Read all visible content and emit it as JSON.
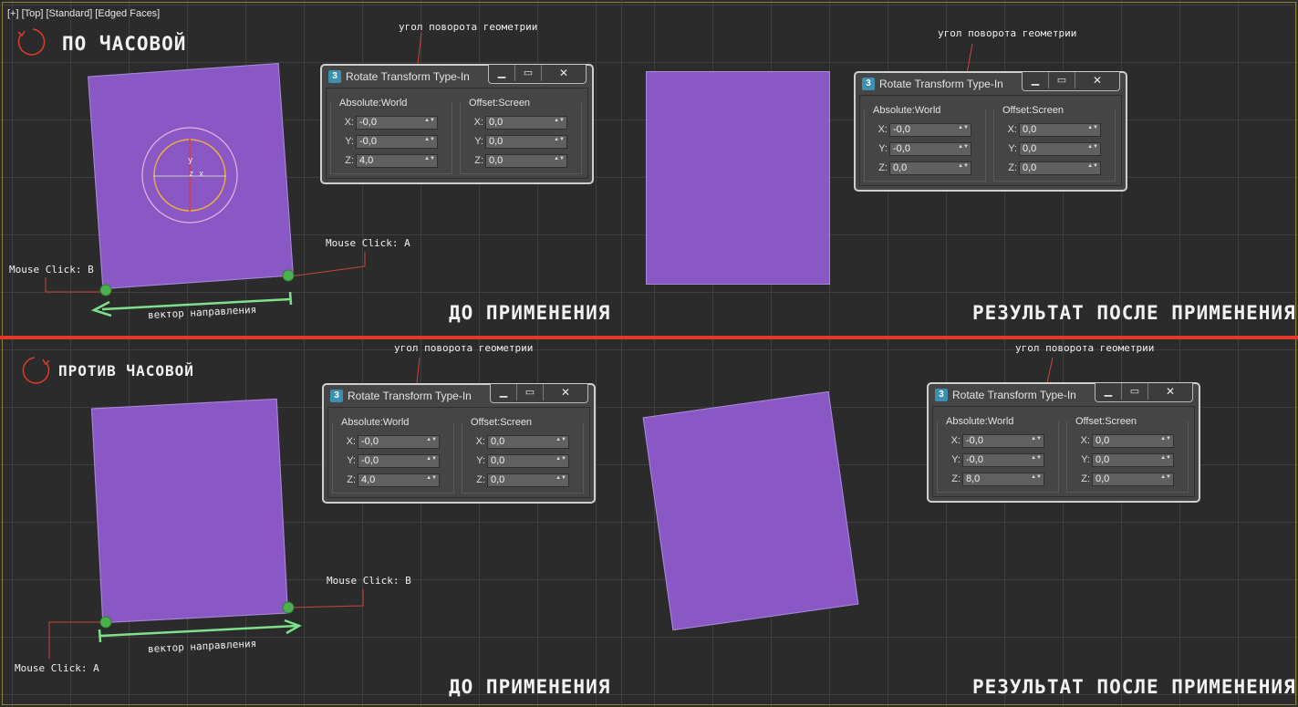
{
  "viewport_label": "[+] [Top] [Standard] [Edged Faces]",
  "top": {
    "direction_label": "ПО ЧАСОВОЙ",
    "before_caption": "ДО ПРИМЕНЕНИЯ",
    "after_caption": "РЕЗУЛЬТАТ ПОСЛЕ ПРИМЕНЕНИЯ",
    "angle_note_left": "угол поворота геометрии",
    "angle_note_right": "угол поворота геометрии",
    "click_a": "Mouse Click: A",
    "click_b": "Mouse Click: B",
    "vector": "вектор направления",
    "gizmo_y": "y",
    "gizmo_zx": "z x",
    "dialog_left": {
      "title": "Rotate Transform Type-In",
      "abs_title": "Absolute:World",
      "off_title": "Offset:Screen",
      "lx": "X:",
      "ly": "Y:",
      "lz": "Z:",
      "ax": "-0,0",
      "ay": "-0,0",
      "az": "4,0",
      "ox": "0,0",
      "oy": "0,0",
      "oz": "0,0"
    },
    "dialog_right": {
      "title": "Rotate Transform Type-In",
      "abs_title": "Absolute:World",
      "off_title": "Offset:Screen",
      "lx": "X:",
      "ly": "Y:",
      "lz": "Z:",
      "ax": "-0,0",
      "ay": "-0,0",
      "az": "0,0",
      "ox": "0,0",
      "oy": "0,0",
      "oz": "0,0"
    }
  },
  "bottom": {
    "direction_label": "ПРОТИВ ЧАСОВОЙ",
    "before_caption": "ДО ПРИМЕНЕНИЯ",
    "after_caption": "РЕЗУЛЬТАТ ПОСЛЕ ПРИМЕНЕНИЯ",
    "angle_note_left": "угол поворота геометрии",
    "angle_note_right": "угол поворота геометрии",
    "click_a": "Mouse Click: A",
    "click_b": "Mouse Click: B",
    "vector": "вектор направления",
    "dialog_left": {
      "title": "Rotate Transform Type-In",
      "abs_title": "Absolute:World",
      "off_title": "Offset:Screen",
      "lx": "X:",
      "ly": "Y:",
      "lz": "Z:",
      "ax": "-0,0",
      "ay": "-0,0",
      "az": "4,0",
      "ox": "0,0",
      "oy": "0,0",
      "oz": "0,0"
    },
    "dialog_right": {
      "title": "Rotate Transform Type-In",
      "abs_title": "Absolute:World",
      "off_title": "Offset:Screen",
      "lx": "X:",
      "ly": "Y:",
      "lz": "Z:",
      "ax": "-0,0",
      "ay": "-0,0",
      "az": "8,0",
      "ox": "0,0",
      "oy": "0,0",
      "oz": "0,0"
    }
  },
  "window_controls": {
    "minimize": "▁",
    "maximize": "▭",
    "close": "✕"
  },
  "app_icon_glyph": "3",
  "spinner_arrows": "▲▼",
  "colors": {
    "plane": "#8a58c4",
    "accent_red": "#e03a2a",
    "arrow_green": "#7ee08a",
    "grid": "#3f3f3f",
    "background": "#2b2b2b"
  }
}
